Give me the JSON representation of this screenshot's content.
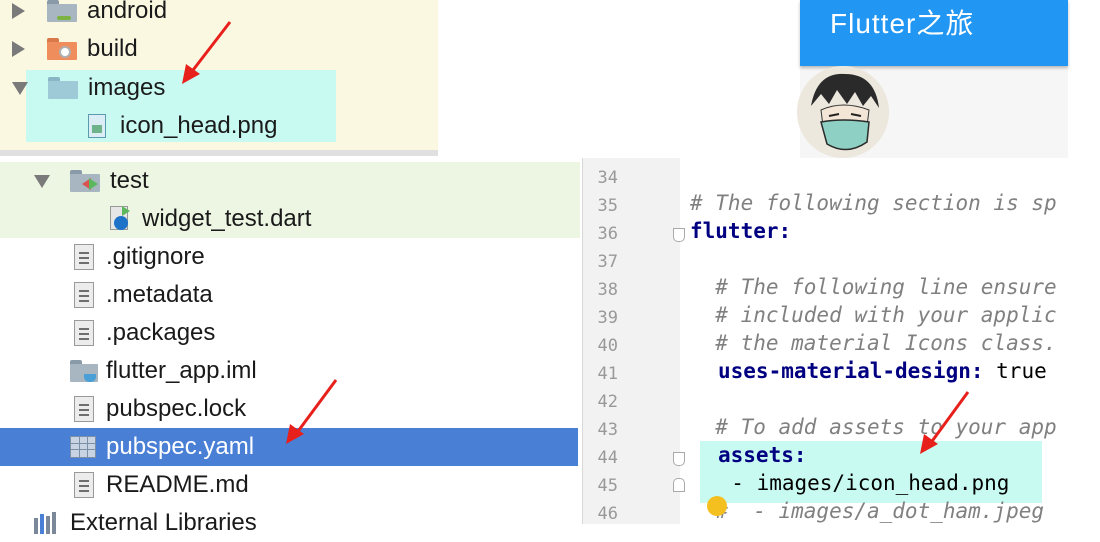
{
  "top_tree": {
    "items": [
      {
        "label": "android",
        "icon": "android-folder-icon"
      },
      {
        "label": "build",
        "icon": "build-folder-icon"
      },
      {
        "label": "images",
        "icon": "folder-icon"
      },
      {
        "label": "icon_head.png",
        "icon": "image-file-icon"
      }
    ]
  },
  "flutter_preview": {
    "title": "Flutter之旅"
  },
  "project_tree": {
    "items": [
      {
        "label": "test"
      },
      {
        "label": "widget_test.dart"
      },
      {
        "label": ".gitignore"
      },
      {
        "label": ".metadata"
      },
      {
        "label": ".packages"
      },
      {
        "label": "flutter_app.iml"
      },
      {
        "label": "pubspec.lock"
      },
      {
        "label": "pubspec.yaml",
        "selected": true
      },
      {
        "label": "README.md"
      },
      {
        "label": "External Libraries"
      }
    ],
    "selected_color": "#4a7fd6"
  },
  "editor": {
    "line_numbers": [
      "34",
      "35",
      "36",
      "37",
      "38",
      "39",
      "40",
      "41",
      "42",
      "43",
      "44",
      "45",
      "46"
    ],
    "lines": [
      "",
      "# The following section is sp",
      "flutter:",
      "",
      "  # The following line ensure",
      "  # included with your applic",
      "  # the material Icons class.",
      "uses-material-design:",
      " true",
      "",
      "  # To add assets to your app",
      "assets:",
      "  - images/icon_head.png",
      "  #  - images/a_dot_ham.jpeg"
    ]
  },
  "colors": {
    "highlight_cyan": "#c8faf2",
    "test_green": "#ecf6e3",
    "top_panel_yellow": "#fbf8e2",
    "flutter_blue": "#2196f3",
    "arrow_red": "#e8201c"
  }
}
